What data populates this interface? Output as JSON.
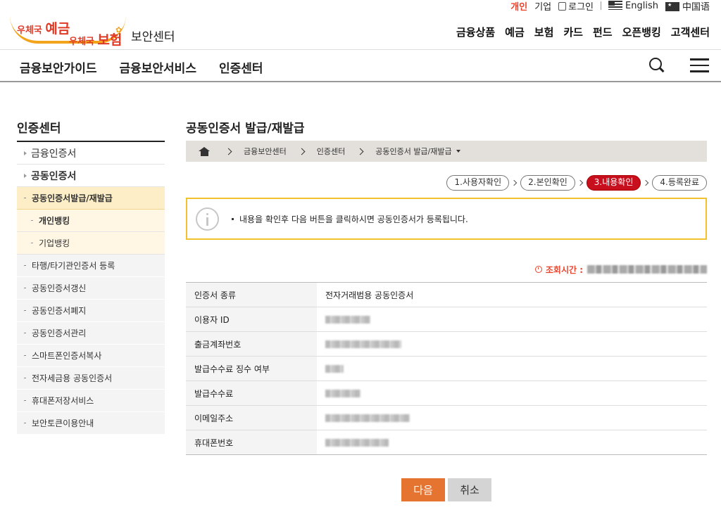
{
  "util": {
    "active": "개인",
    "corp": "기업",
    "login": "로그인",
    "english": "English",
    "chinese": "中国语"
  },
  "logo": {
    "line1_small": "우체국",
    "line1_big": "예금",
    "line2_small": "우체국",
    "line2_big": "보험",
    "sub": "보안센터"
  },
  "gnb": [
    "금융상품",
    "예금",
    "보험",
    "카드",
    "펀드",
    "오픈뱅킹",
    "고객센터"
  ],
  "nav2": [
    "금융보안가이드",
    "금융보안서비스",
    "인증센터"
  ],
  "lnb": {
    "title": "인증센터",
    "items": [
      {
        "label": "금융인증서"
      },
      {
        "label": "공동인증서"
      },
      {
        "label": "공동인증서발급/재발급"
      },
      {
        "label": "개인뱅킹"
      },
      {
        "label": "기업뱅킹"
      },
      {
        "label": "타행/타기관인증서 등록"
      },
      {
        "label": "공동인증서갱신"
      },
      {
        "label": "공동인증서폐지"
      },
      {
        "label": "공동인증서관리"
      },
      {
        "label": "스마트폰인증서복사"
      },
      {
        "label": "전자세금용 공동인증서"
      },
      {
        "label": "휴대폰저장서비스"
      },
      {
        "label": "보안토큰이용안내"
      }
    ]
  },
  "page": {
    "title": "공동인증서 발급/재발급"
  },
  "breadcrumb": [
    "금융보안센터",
    "인증센터",
    "공동인증서 발급/재발급"
  ],
  "steps": [
    "1.사용자확인",
    "2.본인확인",
    "3.내용확인",
    "4.등록완료"
  ],
  "notice": "내용을 확인후 다음 버튼을 클릭하시면 공동인증서가 등록됩니다.",
  "time_label": "조회시간 :",
  "table": [
    {
      "label": "인증서 종류",
      "value": "전자거래범용 공동인증서"
    },
    {
      "label": "이용자 ID",
      "value": ""
    },
    {
      "label": "출금계좌번호",
      "value": ""
    },
    {
      "label": "발급수수료 징수 여부",
      "value": ""
    },
    {
      "label": "발급수수료",
      "value": ""
    },
    {
      "label": "이메일주소",
      "value": ""
    },
    {
      "label": "휴대폰번호",
      "value": ""
    }
  ],
  "buttons": {
    "next": "다음",
    "cancel": "취소"
  }
}
